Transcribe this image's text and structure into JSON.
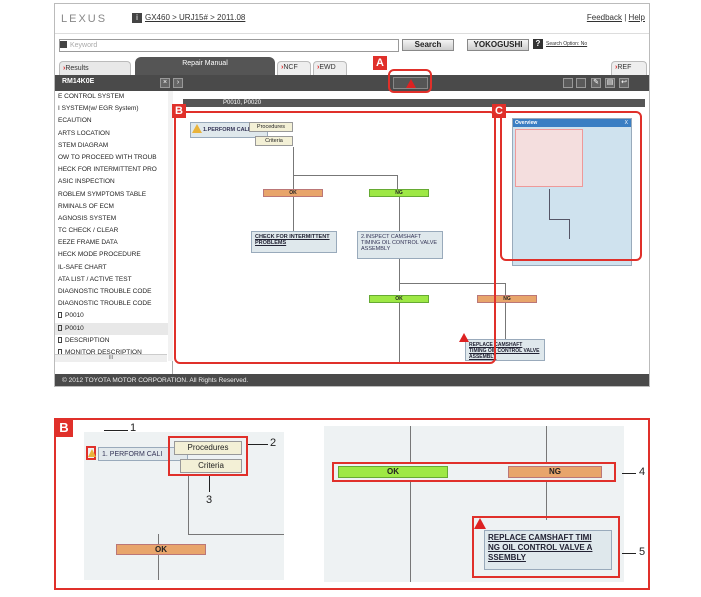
{
  "header": {
    "logo": "LEXUS",
    "info_icon": "i",
    "breadcrumb": "GX460 > URJ15# > 2011.08",
    "feedback_label": "Feedback",
    "separator": "|",
    "help_label": "Help"
  },
  "search": {
    "placeholder": "Keyword",
    "search_label": "Search",
    "yokogushi_label": "YOKOGUSHI",
    "help_q": "?",
    "options_label": "Search Option: No"
  },
  "tabs": {
    "results": "Results",
    "repair_manual": "Repair Manual",
    "ncf": "NCF",
    "ewd": "EWD",
    "ref": "REF"
  },
  "toolbar": {
    "doc_code": "RM14K0E",
    "close_glyph": "×",
    "next_glyph": "›"
  },
  "sidebar": {
    "items": [
      {
        "label": "E CONTROL SYSTEM",
        "sel": false
      },
      {
        "label": "I SYSTEM(w/ EGR System)",
        "sel": false
      },
      {
        "label": "ECAUTION",
        "sel": false
      },
      {
        "label": "ARTS LOCATION",
        "sel": false
      },
      {
        "label": "STEM DIAGRAM",
        "sel": false
      },
      {
        "label": "OW TO PROCEED WITH TROUB",
        "sel": false
      },
      {
        "label": "HECK FOR INTERMITTENT PRO",
        "sel": false
      },
      {
        "label": "ASIC INSPECTION",
        "sel": false
      },
      {
        "label": "ROBLEM SYMPTOMS TABLE",
        "sel": false
      },
      {
        "label": "RMINALS OF ECM",
        "sel": false
      },
      {
        "label": "AGNOSIS SYSTEM",
        "sel": false
      },
      {
        "label": "TC CHECK / CLEAR",
        "sel": false
      },
      {
        "label": "EEZE FRAME DATA",
        "sel": false
      },
      {
        "label": "HECK MODE PROCEDURE",
        "sel": false
      },
      {
        "label": "IL-SAFE CHART",
        "sel": false
      },
      {
        "label": "ATA LIST / ACTIVE TEST",
        "sel": false
      },
      {
        "label": "DIAGNOSTIC TROUBLE CODE",
        "sel": false
      },
      {
        "label": "DIAGNOSTIC TROUBLE CODE",
        "sel": false
      },
      {
        "label": "P0010",
        "sel": false,
        "doc": true
      },
      {
        "label": "P0010",
        "sel": true,
        "doc": true
      },
      {
        "label": "DESCRIPTION",
        "sel": false,
        "doc": true
      },
      {
        "label": "MONITOR DESCRIPTION",
        "sel": false,
        "doc": true
      }
    ],
    "scroll_glyph": "III"
  },
  "main": {
    "code_bar": "P0010, P0020",
    "step1": "1.PERFORM CALI",
    "procedures": "Procedures",
    "criteria": "Criteria",
    "ok": "OK",
    "ng": "NG",
    "check_intermittent": "CHECK FOR INTERMITTENT PROBLEMS",
    "step2": "2.INSPECT CAMSHAFT TIMING OIL CONTROL VALVE ASSEMBLY",
    "ok2": "OK",
    "ng2": "NG",
    "replace": "REPLACE CAMSHAFT TIMING OIL CONTROL VALVE ASSEMBLY"
  },
  "overview": {
    "title": "Overview",
    "close": "X"
  },
  "footer": {
    "copyright": "© 2012 TOYOTA MOTOR CORPORATION. All Rights Reserved."
  },
  "callouts": {
    "a": "A",
    "b": "B",
    "c": "C"
  },
  "detail": {
    "badge": "B",
    "step1": "1. PERFORM CALI",
    "procedures": "Procedures",
    "criteria": "Criteria",
    "ok_left": "OK",
    "ok_right": "OK",
    "ng_right": "NG",
    "replace_line1": "REPLACE CAMSHAFT TIMI",
    "replace_line2": "NG OIL CONTROL VALVE A",
    "replace_line3": "SSEMBLY",
    "num1": "1",
    "num2": "2",
    "num3": "3",
    "num4": "4",
    "num5": "5"
  },
  "colors": {
    "callout_red": "#e0302a",
    "ok_orange": "#e8a56b",
    "ng_green": "#9ee845",
    "dark_bar": "#4a4a4a"
  }
}
